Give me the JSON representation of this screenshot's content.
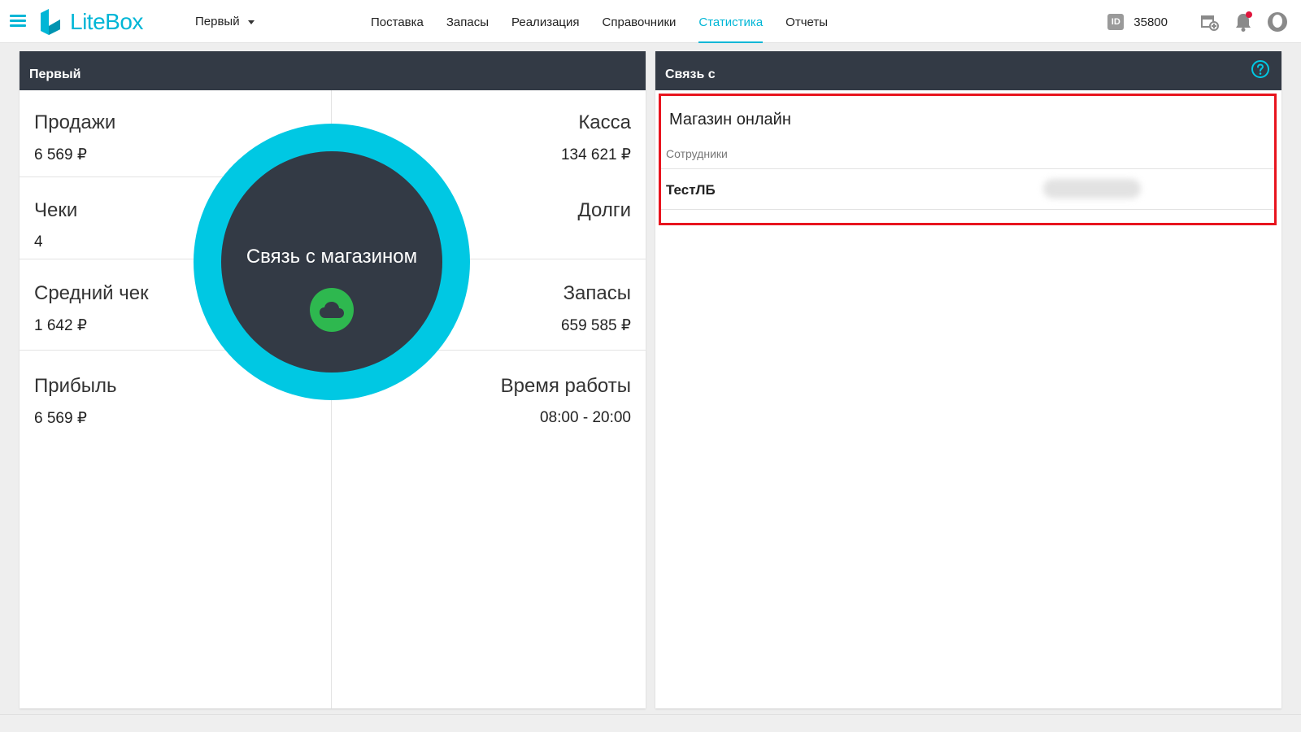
{
  "header": {
    "logo_text": "LiteBox",
    "store_selector": "Первый",
    "nav": [
      "Поставка",
      "Запасы",
      "Реализация",
      "Справочники",
      "Статистика",
      "Отчеты"
    ],
    "active_nav": "Статистика",
    "account_id_badge": "ID",
    "account_id": "35800"
  },
  "left_panel": {
    "title": "Первый",
    "stats": {
      "sales_label": "Продажи",
      "sales_value": "6 569 ₽",
      "cash_label": "Касса",
      "cash_value": "134 621 ₽",
      "checks_label": "Чеки",
      "checks_value": "4",
      "debts_label": "Долги",
      "avg_check_label": "Средний чек",
      "avg_check_value": "1 642 ₽",
      "stock_label": "Запасы",
      "stock_value": "659 585 ₽",
      "profit_label": "Прибыль",
      "profit_value": "6 569 ₽",
      "hours_label": "Время работы",
      "hours_value": "08:00 - 20:00"
    },
    "connection_circle": {
      "text": "Связь с магазином",
      "status_icon": "cloud-icon",
      "status_color": "#2eb84f"
    }
  },
  "right_panel": {
    "title": "Связь с",
    "shop_status": "Магазин онлайн",
    "employees_label": "Сотрудники",
    "employees": [
      {
        "name": "ТестЛБ"
      }
    ]
  },
  "colors": {
    "accent": "#00b6d6",
    "panel_header": "#333a45",
    "online": "#2eb84f",
    "highlight": "#e8141e"
  }
}
